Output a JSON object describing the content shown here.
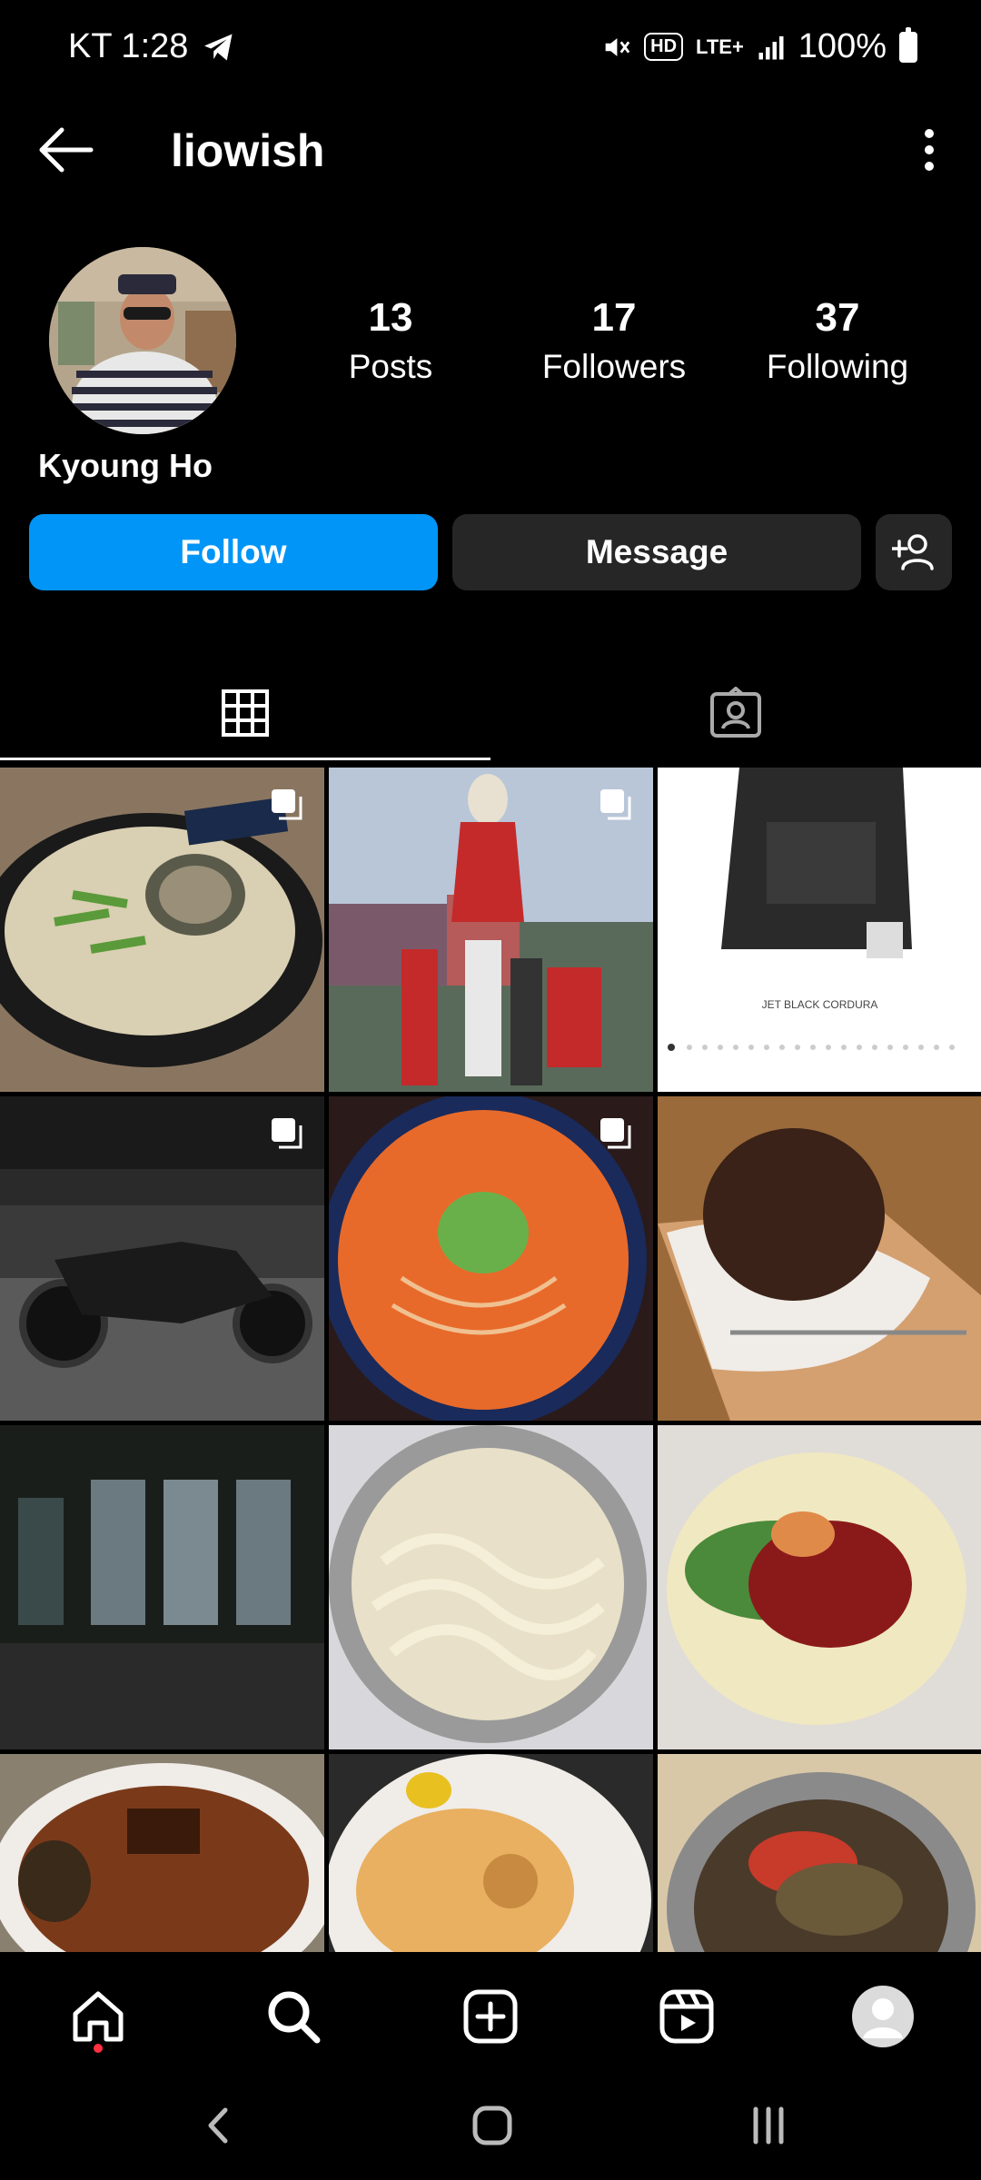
{
  "status_bar": {
    "carrier_time": "KT 1:28",
    "network": "LTE+",
    "hd": "HD",
    "battery": "100%"
  },
  "header": {
    "username": "liowish"
  },
  "profile": {
    "display_name": "Kyoung Ho",
    "stats": [
      {
        "count": "13",
        "label": "Posts"
      },
      {
        "count": "17",
        "label": "Followers"
      },
      {
        "count": "37",
        "label": "Following"
      }
    ]
  },
  "actions": {
    "follow_label": "Follow",
    "message_label": "Message"
  },
  "tabs": [
    {
      "icon": "grid-icon",
      "selected": true
    },
    {
      "icon": "tagged-icon",
      "selected": false
    }
  ],
  "posts": [
    {
      "subject": "abalone-soup",
      "multi": true
    },
    {
      "subject": "money-heist-costumes",
      "multi": true
    },
    {
      "subject": "backpack",
      "multi": false,
      "caption": "JET BLACK CORDURA"
    },
    {
      "subject": "motorcycle",
      "multi": true
    },
    {
      "subject": "spicy-noodle-soup",
      "multi": true
    },
    {
      "subject": "chocolate-dessert",
      "multi": false
    },
    {
      "subject": "restaurant-windows",
      "multi": false
    },
    {
      "subject": "noodle-bowl",
      "multi": false
    },
    {
      "subject": "spicy-cold-noodles",
      "multi": false
    },
    {
      "subject": "braised-meat",
      "multi": false
    },
    {
      "subject": "fried-dish",
      "multi": false
    },
    {
      "subject": "bibim-noodles",
      "multi": false
    }
  ],
  "bottom_nav": [
    {
      "icon": "home-icon"
    },
    {
      "icon": "search-icon"
    },
    {
      "icon": "create-icon"
    },
    {
      "icon": "reels-icon"
    },
    {
      "icon": "profile-icon"
    }
  ],
  "colors": {
    "accent": "#0095f6",
    "secondary_button": "#262626",
    "notification": "#ff3040"
  }
}
